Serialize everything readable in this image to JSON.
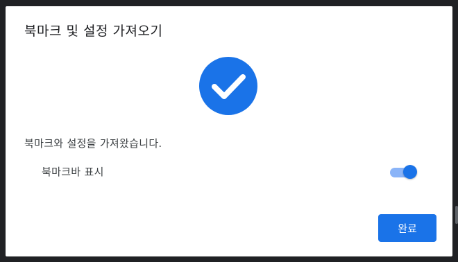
{
  "dialog": {
    "title": "북마크 및 설정 가져오기",
    "icon": "check-circle-icon",
    "accent_color": "#1a73e8",
    "message": "북마크와 설정을 가져왔습니다.",
    "toggle": {
      "label": "북마크바 표시",
      "checked": true
    },
    "done_label": "완료"
  }
}
